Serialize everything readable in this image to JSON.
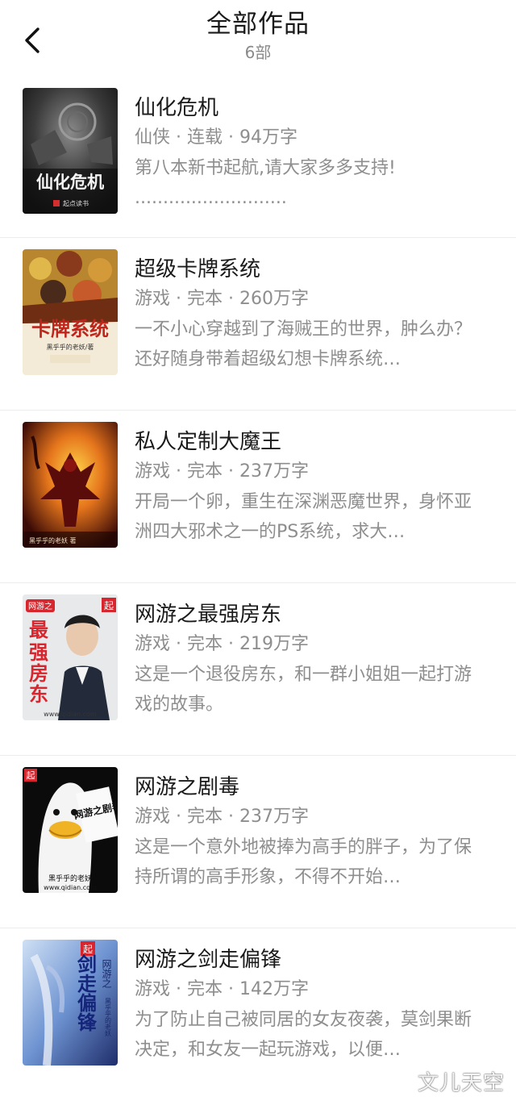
{
  "header": {
    "title": "全部作品",
    "count": "6部",
    "back_icon": "chevron-left-icon"
  },
  "books": [
    {
      "title": "仙化危机",
      "meta": "仙侠 · 连载 · 94万字",
      "desc": "第八本新书起航,请大家多多支持!\n...........................",
      "cover_text": "仙化危机",
      "cover_publisher": "起点读书",
      "cover_colors": [
        "#1c1c1c",
        "#6b6b6b"
      ]
    },
    {
      "title": "超级卡牌系统",
      "meta": "游戏 · 完本 · 260万字",
      "desc": "一不小心穿越到了海贼王的世界，肿么办？还好随身带着超级幻想卡牌系统…",
      "cover_text": "卡牌系统",
      "cover_author": "黑乎乎的老妖/著",
      "cover_colors": [
        "#c9a24a",
        "#7a3b22"
      ]
    },
    {
      "title": "私人定制大魔王",
      "meta": "游戏 · 完本 · 237万字",
      "desc": "开局一个卵，重生在深渊恶魔世界，身怀亚洲四大邪术之一的PS系统，求大…",
      "cover_author": "黑乎乎的老妖 著",
      "cover_colors": [
        "#e8b21c",
        "#4a0f08"
      ]
    },
    {
      "title": "网游之最强房东",
      "meta": "游戏 · 完本 · 219万字",
      "desc": "这是一个退役房东，和一群小姐姐一起打游戏的故事。",
      "cover_text": "最强房东",
      "cover_prefix": "网游之",
      "cover_author": "黑乎乎的老妖",
      "cover_site": "www.qidian.com",
      "cover_colors": [
        "#f2efe8",
        "#d7262d"
      ]
    },
    {
      "title": "网游之剧毒",
      "meta": "游戏 · 完本 · 237万字",
      "desc": "这是一个意外地被捧为高手的胖子，为了保持所谓的高手形象，不得不开始…",
      "cover_text": "网游之剧毒",
      "cover_author": "黑乎乎的老妖",
      "cover_site": "www.qidian.com",
      "cover_colors": [
        "#0b0b0b",
        "#f4f4f4"
      ]
    },
    {
      "title": "网游之剑走偏锋",
      "meta": "游戏 · 完本 · 142万字",
      "desc": "为了防止自己被同居的女友夜袭，莫剑果断决定，和女友一起玩游戏，以便…",
      "cover_text": "剑走偏锋",
      "cover_prefix": "网游之",
      "cover_author": "黑乎乎的老妖",
      "cover_colors": [
        "#8fb6e6",
        "#2b3f86"
      ]
    }
  ],
  "watermark": "文儿天空"
}
